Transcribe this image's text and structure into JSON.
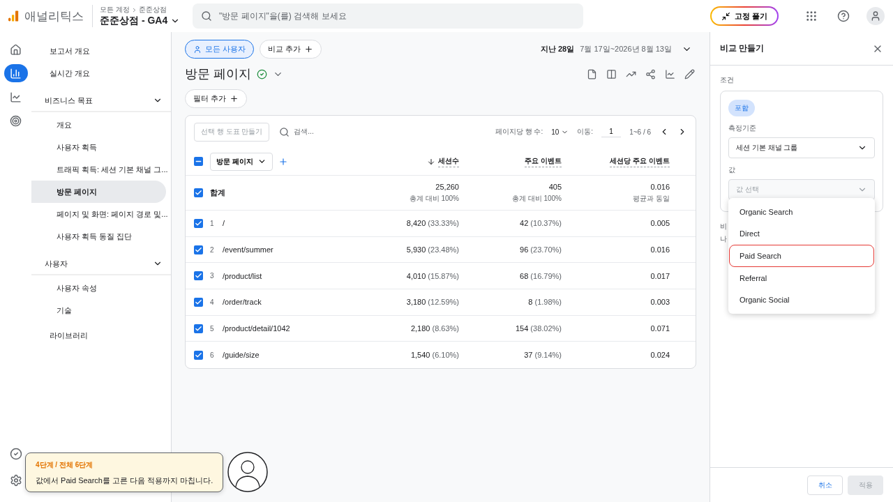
{
  "header": {
    "brand": "애널리틱스",
    "breadcrumb": [
      "모든 계정",
      "준준상점"
    ],
    "property": "준준상점 - GA4",
    "search_placeholder": "\"방문 페이지\"을(를) 검색해 보세요",
    "pin_button": "고정 풀기"
  },
  "rail": {
    "items": [
      {
        "kind": "home",
        "selected": false
      },
      {
        "kind": "reports",
        "selected": true
      },
      {
        "kind": "explore",
        "selected": false
      },
      {
        "kind": "advertising",
        "selected": false
      }
    ],
    "bottom": [
      {
        "kind": "check"
      },
      {
        "kind": "settings"
      }
    ]
  },
  "sidebar": {
    "items": [
      {
        "label": "보고서 개요",
        "selected": false
      },
      {
        "label": "실시간 개요",
        "selected": false
      },
      {
        "label": "비즈니스 목표",
        "expanded": true,
        "children": [
          {
            "label": "개요",
            "selected": false
          },
          {
            "label": "사용자 획득",
            "selected": false
          },
          {
            "label": "트래픽 획득: 세션 기본 채널 그...",
            "selected": false
          },
          {
            "label": "방문 페이지",
            "selected": true
          },
          {
            "label": "페이지 및 화면: 페이지 경로 및...",
            "selected": false
          },
          {
            "label": "사용자 획득 동질 집단",
            "selected": false
          }
        ]
      },
      {
        "label": "사용자",
        "expanded": true,
        "children": [
          {
            "label": "사용자 속성",
            "selected": false
          },
          {
            "label": "기술",
            "selected": false
          }
        ]
      },
      {
        "label": "라이브러리",
        "selected": false
      }
    ]
  },
  "main": {
    "segment": "모든 사용자",
    "add_compare": "비교 추가",
    "date_label": "지난 28일",
    "date_range": "7월 17일~2026년 8월 13일",
    "title": "방문 페이지",
    "filter": "필터 추가",
    "table": {
      "chart_button": "선택 행 도표 만들기",
      "search_placeholder": "검색...",
      "rows_per_page_label": "페이지당 행 수:",
      "rows_per_page": "10",
      "select_all_partial": true,
      "goto_label": "이동:",
      "goto_value": "1",
      "range": "1~6 / 6",
      "dimension": "방문 페이지",
      "columns": [
        "세션수",
        "주요 이벤트",
        "세션당 주요 이벤트"
      ],
      "total": {
        "label": "합계",
        "checked": true,
        "values": [
          "25,260",
          "405",
          "0.016"
        ],
        "notes": [
          "총계 대비 100%",
          "총계 대비 100%",
          "평균과 동일"
        ]
      },
      "rows": [
        {
          "rank": "1",
          "page": "/",
          "sessions": "8,420",
          "sessions_pct": "(33.33%)",
          "events": "42",
          "events_pct": "(10.37%)",
          "ratio": "0.005",
          "checked": true
        },
        {
          "rank": "2",
          "page": "/event/summer",
          "sessions": "5,930",
          "sessions_pct": "(23.48%)",
          "events": "96",
          "events_pct": "(23.70%)",
          "ratio": "0.016",
          "checked": true
        },
        {
          "rank": "3",
          "page": "/product/list",
          "sessions": "4,010",
          "sessions_pct": "(15.87%)",
          "events": "68",
          "events_pct": "(16.79%)",
          "ratio": "0.017",
          "checked": true
        },
        {
          "rank": "4",
          "page": "/order/track",
          "sessions": "3,180",
          "sessions_pct": "(12.59%)",
          "events": "8",
          "events_pct": "(1.98%)",
          "ratio": "0.003",
          "checked": true
        },
        {
          "rank": "5",
          "page": "/product/detail/1042",
          "sessions": "2,180",
          "sessions_pct": "(8.63%)",
          "events": "154",
          "events_pct": "(38.02%)",
          "ratio": "0.071",
          "checked": true
        },
        {
          "rank": "6",
          "page": "/guide/size",
          "sessions": "1,540",
          "sessions_pct": "(6.10%)",
          "events": "37",
          "events_pct": "(9.14%)",
          "ratio": "0.024",
          "checked": true
        }
      ]
    }
  },
  "panel": {
    "title": "비교 만들기",
    "condition_label": "조건",
    "include_chip": "포함",
    "dimension_label": "측정기준",
    "dimension_value": "세션 기본 채널 그룹",
    "value_label": "값",
    "value_placeholder": "값 선택",
    "note_lines": [
      "비",
      "나"
    ],
    "options": [
      {
        "label": "Organic Search",
        "highlighted": false
      },
      {
        "label": "Direct",
        "highlighted": false
      },
      {
        "label": "Paid Search",
        "highlighted": true
      },
      {
        "label": "Referral",
        "highlighted": false
      },
      {
        "label": "Organic Social",
        "highlighted": false
      }
    ],
    "cancel": "취소",
    "apply": {
      "label": "적용",
      "disabled": true
    }
  },
  "guide": {
    "step": "4단계 / 전체 6단계",
    "message": "값에서 Paid Search를 고른 다음 적용까지 마칩니다."
  }
}
